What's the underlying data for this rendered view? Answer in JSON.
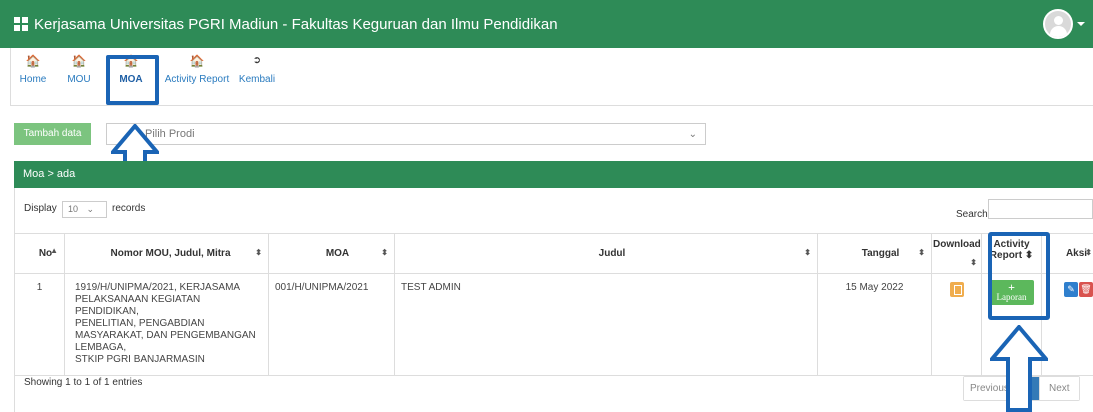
{
  "app": {
    "title": "Kerjasama Universitas PGRI Madiun - Fakultas Keguruan dan Ilmu Pendidikan"
  },
  "nav": {
    "items": [
      {
        "label": "Home"
      },
      {
        "label": "MOU"
      },
      {
        "label": "MOA"
      },
      {
        "label": "Activity Report"
      },
      {
        "label": "Kembali"
      }
    ]
  },
  "toolbar": {
    "add_label": "Tambah data",
    "prodi_placeholder": "Pilih Prodi"
  },
  "panel": {
    "breadcrumb": "Moa > ada"
  },
  "list_controls": {
    "display_label": "Display",
    "records_value": "10",
    "records_label": "records",
    "search_label": "Search:"
  },
  "table": {
    "headers": {
      "no": "No",
      "nomor": "Nomor MOU, Judul, Mitra",
      "moa": "MOA",
      "judul": "Judul",
      "tanggal": "Tanggal",
      "download": "Download",
      "activity_1": "Activity",
      "activity_2": "Report",
      "aksi": "Aksi"
    },
    "rows": [
      {
        "no": "1",
        "nomor_lines": [
          "1919/H/UNIPMA/2021, KERJASAMA",
          "PELAKSANAAN KEGIATAN PENDIDIKAN,",
          "PENELITIAN, PENGABDIAN",
          "MASYARAKAT, DAN PENGEMBANGAN",
          "LEMBAGA,",
          "STKIP PGRI BANJARMASIN"
        ],
        "moa": "001/H/UNIPMA/2021",
        "judul": "TEST ADMIN",
        "tanggal": "15 May 2022",
        "laporan_label": "Laporan"
      }
    ]
  },
  "footer": {
    "showing": "Showing 1 to 1 of 1 entries",
    "previous": "Previous",
    "current_page": "1",
    "next": "Next"
  },
  "colors": {
    "brand_green": "#2e8b57",
    "highlight_blue": "#1a64b5"
  },
  "icons": [
    "home-icon",
    "sign-out-icon",
    "user-avatar-icon",
    "file-icon",
    "pencil-icon",
    "trash-icon",
    "plus-icon"
  ]
}
